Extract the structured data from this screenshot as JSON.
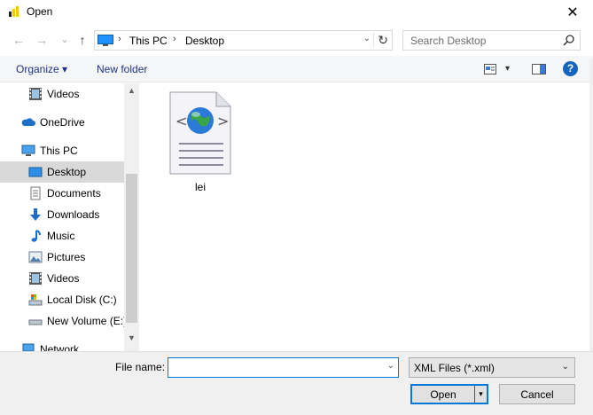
{
  "window": {
    "title": "Open",
    "close_glyph": "✕"
  },
  "nav": {
    "back_glyph": "←",
    "forward_glyph": "→",
    "recent_glyph": "⌄",
    "up_glyph": "↑",
    "address_segments": [
      "This PC",
      "Desktop"
    ],
    "address_sep": "›",
    "address_dropdown_glyph": "⌄",
    "refresh_glyph": "↻",
    "search_placeholder": "Search Desktop"
  },
  "toolbar": {
    "organize_label": "Organize ▾",
    "new_folder_label": "New folder",
    "view_dropdown_glyph": "▾",
    "help_glyph": "?"
  },
  "sidebar": {
    "items": [
      {
        "label": "Videos",
        "icon": "video-icon"
      },
      {
        "label": "OneDrive",
        "icon": "cloud-icon"
      },
      {
        "label": "This PC",
        "icon": "computer-icon"
      },
      {
        "label": "Desktop",
        "icon": "desktop-icon",
        "selected": true
      },
      {
        "label": "Documents",
        "icon": "document-icon"
      },
      {
        "label": "Downloads",
        "icon": "download-icon"
      },
      {
        "label": "Music",
        "icon": "music-icon"
      },
      {
        "label": "Pictures",
        "icon": "picture-icon"
      },
      {
        "label": "Videos",
        "icon": "video-icon"
      },
      {
        "label": "Local Disk (C:)",
        "icon": "drive-icon"
      },
      {
        "label": "New Volume (E:)",
        "icon": "drive-icon"
      },
      {
        "label": "Network",
        "icon": "network-icon"
      }
    ],
    "scroll_up_glyph": "▲",
    "scroll_down_glyph": "▼"
  },
  "files": [
    {
      "name": "lei",
      "icon": "xml-file-icon"
    }
  ],
  "footer": {
    "file_name_label": "File name:",
    "file_name_value": "",
    "file_name_dropdown_glyph": "⌄",
    "file_type": "XML Files (*.xml)",
    "file_type_dropdown_glyph": "⌄",
    "open_label": "Open",
    "open_split_glyph": "▾",
    "cancel_label": "Cancel"
  },
  "colors": {
    "accent": "#0078d7",
    "selected_bg": "#d9d9d9",
    "link_text": "#1e3287"
  }
}
